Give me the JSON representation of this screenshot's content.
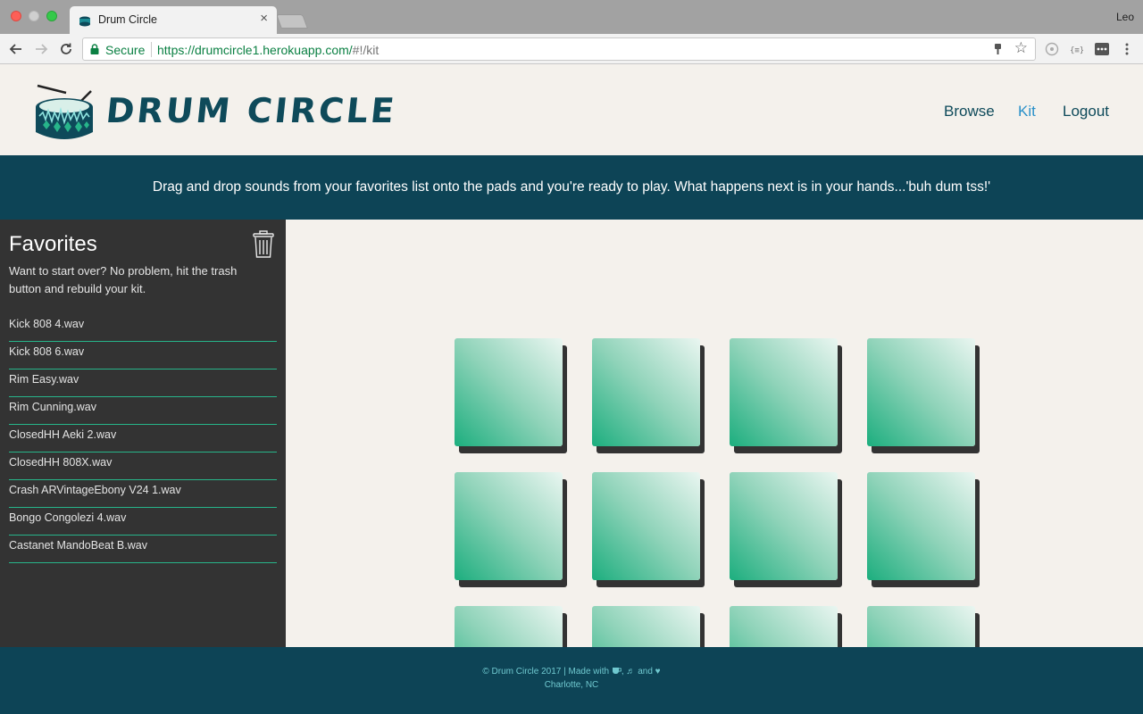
{
  "browser": {
    "tab_title": "Drum Circle",
    "tab_close": "×",
    "profile": "Leo",
    "secure_label": "Secure",
    "url_scheme_host": "https://drumcircle1.herokuapp.com/",
    "url_path": "#!/kit"
  },
  "site": {
    "logo_text": "DRUM CIRCLE",
    "nav": [
      {
        "label": "Browse",
        "active": false
      },
      {
        "label": "Kit",
        "active": true
      },
      {
        "label": "Logout",
        "active": false
      }
    ],
    "banner": "Drag and drop sounds from your favorites list onto the pads and you're ready to play. What happens next is in your hands...'buh dum tss!'"
  },
  "sidebar": {
    "title": "Favorites",
    "description": "Want to start over? No problem, hit the trash button and rebuild your kit.",
    "items": [
      "Kick 808 4.wav",
      "Kick 808 6.wav",
      "Rim Easy.wav",
      "Rim Cunning.wav",
      "ClosedHH Aeki 2.wav",
      "ClosedHH 808X.wav",
      "Crash ARVintageEbony V24 1.wav",
      "Bongo Congolezi 4.wav",
      "Castanet MandoBeat B.wav"
    ]
  },
  "pads": {
    "count": 12,
    "colors": {
      "pad_dark": "#1cae7e",
      "pad_light": "#eaf6f1",
      "shadow": "#333333"
    }
  },
  "footer": {
    "line1_prefix": "© Drum Circle 2017 | Made with",
    "line1_and": "and",
    "line2": "Charlotte, NC"
  },
  "colors": {
    "header_bg": "#0d4456",
    "accent": "#2a91c9",
    "divider": "#27b58a",
    "sidebar_bg": "#333333"
  }
}
